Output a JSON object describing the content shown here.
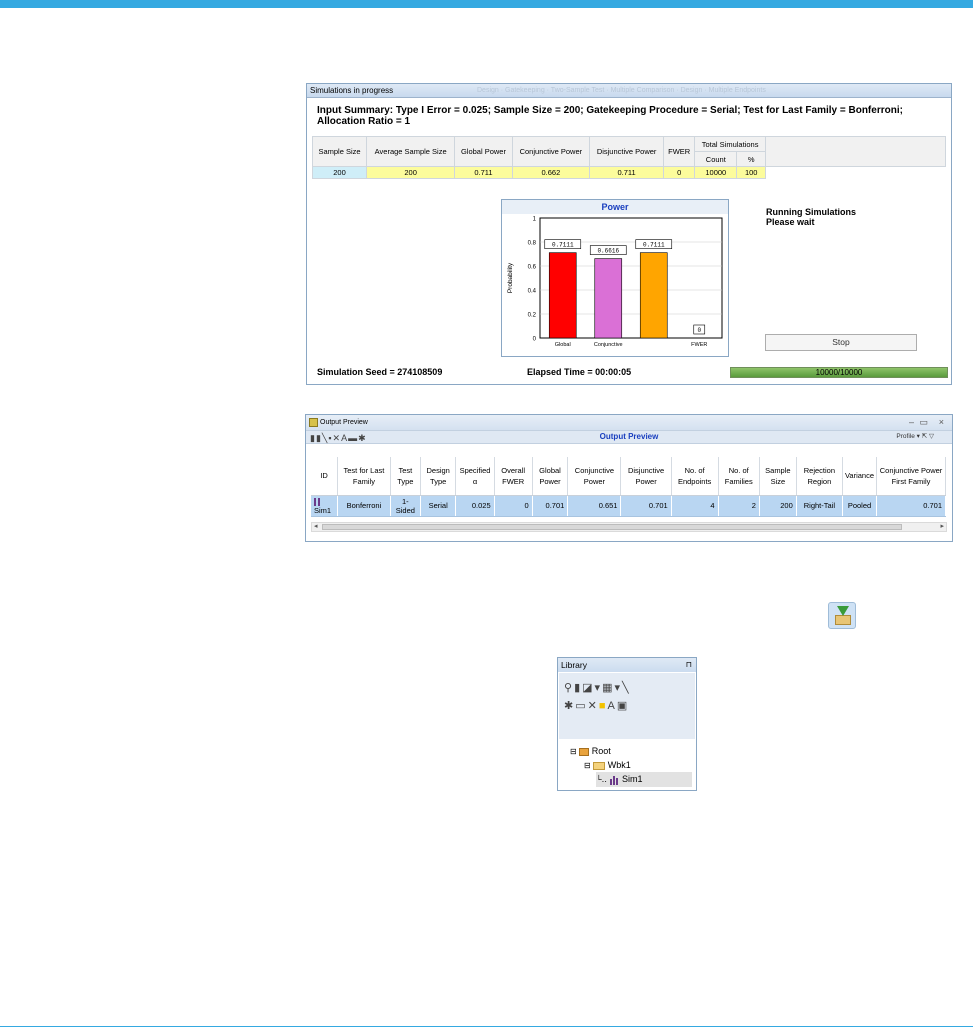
{
  "sim_window": {
    "title": "Simulations in progress",
    "ghost_title": "Design · Gatekeeping · Two-Sample Test · Multiple Comparison · Design · Multiple Endpoints",
    "summary": "Input Summary: Type I Error = 0.025; Sample Size = 200; Gatekeeping Procedure = Serial; Test for Last Family = Bonferroni; Allocation Ratio = 1",
    "table": {
      "headers": [
        "Sample Size",
        "Average Sample Size",
        "Global Power",
        "Conjunctive Power",
        "Disjunctive Power",
        "FWER"
      ],
      "total_header": "Total Simulations",
      "total_sub": [
        "Count",
        "%"
      ],
      "row": [
        "200",
        "200",
        "0.711",
        "0.662",
        "0.711",
        "0",
        "10000",
        "100"
      ]
    },
    "running_line1": "Running Simulations",
    "running_line2": "Please wait",
    "stop_label": "Stop",
    "seed_label": "Simulation Seed = 274108509",
    "elapsed_label": "Elapsed Time =  00:00:05",
    "progress_text": "10000/10000",
    "progress_fraction": 1.0
  },
  "chart_data": {
    "type": "bar",
    "title": "Power",
    "ylabel": "Probability",
    "xlabel": "",
    "categories": [
      "Global",
      "Conjunctive",
      "",
      "FWER"
    ],
    "values": [
      0.7111,
      0.6616,
      0.7111,
      0
    ],
    "data_labels": [
      "0.7111",
      "0.6616",
      "0.7111",
      "0"
    ],
    "colors": [
      "#ff0000",
      "#da70d6",
      "#ffa500",
      "#ffffff"
    ],
    "ylim": [
      0,
      1
    ],
    "yticks": [
      "0",
      "0.2",
      "0.4",
      "0.6",
      "0.8",
      "1"
    ],
    "grid": true
  },
  "output_preview": {
    "title": "Output Preview",
    "toolbar_title": "Output Preview",
    "profile_label": "Profile",
    "minimize": "–",
    "maximize": "▭",
    "close": "×",
    "headers": [
      "ID",
      "Test for Last Family",
      "Test Type",
      "Design Type",
      "Specified α",
      "Overall FWER",
      "Global Power",
      "Conjunctive Power",
      "Disjunctive Power",
      "No. of Endpoints",
      "No. of Families",
      "Sample Size",
      "Rejection Region",
      "Variance",
      "Conjunctive Power First Family"
    ],
    "row": [
      "Sim1",
      "Bonferroni",
      "1-Sided",
      "Serial",
      "0.025",
      "0",
      "0.701",
      "0.651",
      "0.701",
      "4",
      "2",
      "200",
      "Right-Tail",
      "Pooled",
      "0.701"
    ]
  },
  "library": {
    "title": "Library",
    "pin": "⊓",
    "tree": [
      "Root",
      "Wbk1",
      "Sim1"
    ]
  }
}
